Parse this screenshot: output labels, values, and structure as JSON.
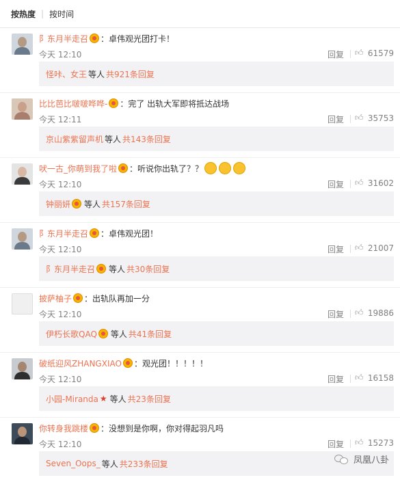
{
  "sort_tabs": {
    "active": "按热度",
    "inactive": "按时间"
  },
  "comments": [
    {
      "user": "阝东月半走召",
      "text": "卓伟观光团打卡！",
      "time": "今天 12:10",
      "reply": "回复",
      "likes": "61579",
      "sub_names": "怪咔、女王",
      "sub_etc": "等人",
      "sub_total": "共921条回复"
    },
    {
      "user": "比比芭比啵啵哗哗-",
      "text": "完了 出轨大军即将抵达战场",
      "time": "今天 12:11",
      "reply": "回复",
      "likes": "35753",
      "sub_names": "京山紫紫留声机",
      "sub_etc": "等人",
      "sub_total": "共143条回复"
    },
    {
      "user": "吠一古_你萌到我了啦",
      "text": "听说你出轨了？？",
      "time": "今天 12:10",
      "reply": "回复",
      "likes": "31602",
      "sub_names": "钟丽妍",
      "sub_etc": "等人",
      "sub_total": "共157条回复"
    },
    {
      "user": "阝东月半走召",
      "text": "卓伟观光团！",
      "time": "今天 12:10",
      "reply": "回复",
      "likes": "21007",
      "sub_names": "阝东月半走召",
      "sub_etc": "等人",
      "sub_total": "共30条回复"
    },
    {
      "user": "披萨柚子",
      "text": "出轨队再加一分",
      "time": "今天 12:10",
      "reply": "回复",
      "likes": "19886",
      "sub_names": "伊朽长歌QAQ",
      "sub_etc": "等人",
      "sub_total": "共41条回复"
    },
    {
      "user": "破纸迎风ZHANGXIAO",
      "text": "观光团！！！！！",
      "time": "今天 12:10",
      "reply": "回复",
      "likes": "16158",
      "sub_names": "小园-Miranda",
      "sub_etc": "等人",
      "sub_total": "共23条回复"
    },
    {
      "user": "你转身我跳楼",
      "text": "没想到是你啊，你对得起羽凡吗",
      "time": "今天 12:10",
      "reply": "回复",
      "likes": "15273",
      "sub_names": "Seven_Oops_",
      "sub_etc": "等人",
      "sub_total": "共233条回复"
    }
  ],
  "watermark": "凤凰八卦",
  "colors": {
    "username": "#eb7350",
    "subbox_bg": "#f2f2f5",
    "meta": "#808080"
  },
  "icons": {
    "verified_badge": "weibo-vip-badge-icon",
    "like": "thumbs-up-icon",
    "emoji": "smile-emoji-icon"
  }
}
